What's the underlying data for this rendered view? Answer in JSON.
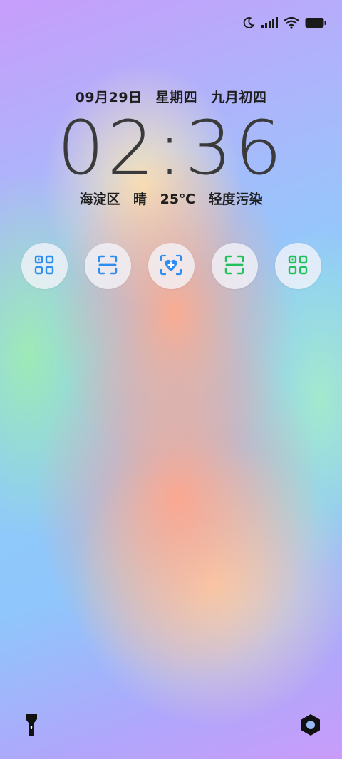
{
  "lockscreen": {
    "date": "09月29日",
    "weekday": "星期四",
    "lunar_date": "九月初四",
    "time": "02:36",
    "location": "海淀区",
    "weather": "晴",
    "temperature": "25℃",
    "air_quality": "轻度污染"
  },
  "status_bar": {
    "icons": [
      "moon-icon",
      "signal-icon",
      "wifi-icon",
      "battery-icon"
    ]
  },
  "shortcuts": [
    {
      "name": "qr-scan-shortcut",
      "icon": "qr-grid-icon",
      "color": "#2f8cf0"
    },
    {
      "name": "scanner-shortcut",
      "icon": "scan-frame-icon",
      "color": "#2f8cf0"
    },
    {
      "name": "health-code-shortcut",
      "icon": "heart-plus-icon",
      "color": "#2f8cf0"
    },
    {
      "name": "green-scan-shortcut",
      "icon": "scan-frame-icon",
      "color": "#21c05a"
    },
    {
      "name": "green-qr-shortcut",
      "icon": "qr-grid-icon",
      "color": "#21c05a"
    }
  ],
  "bottom_actions": {
    "left": "flashlight-icon",
    "right": "camera-shutter-icon"
  }
}
